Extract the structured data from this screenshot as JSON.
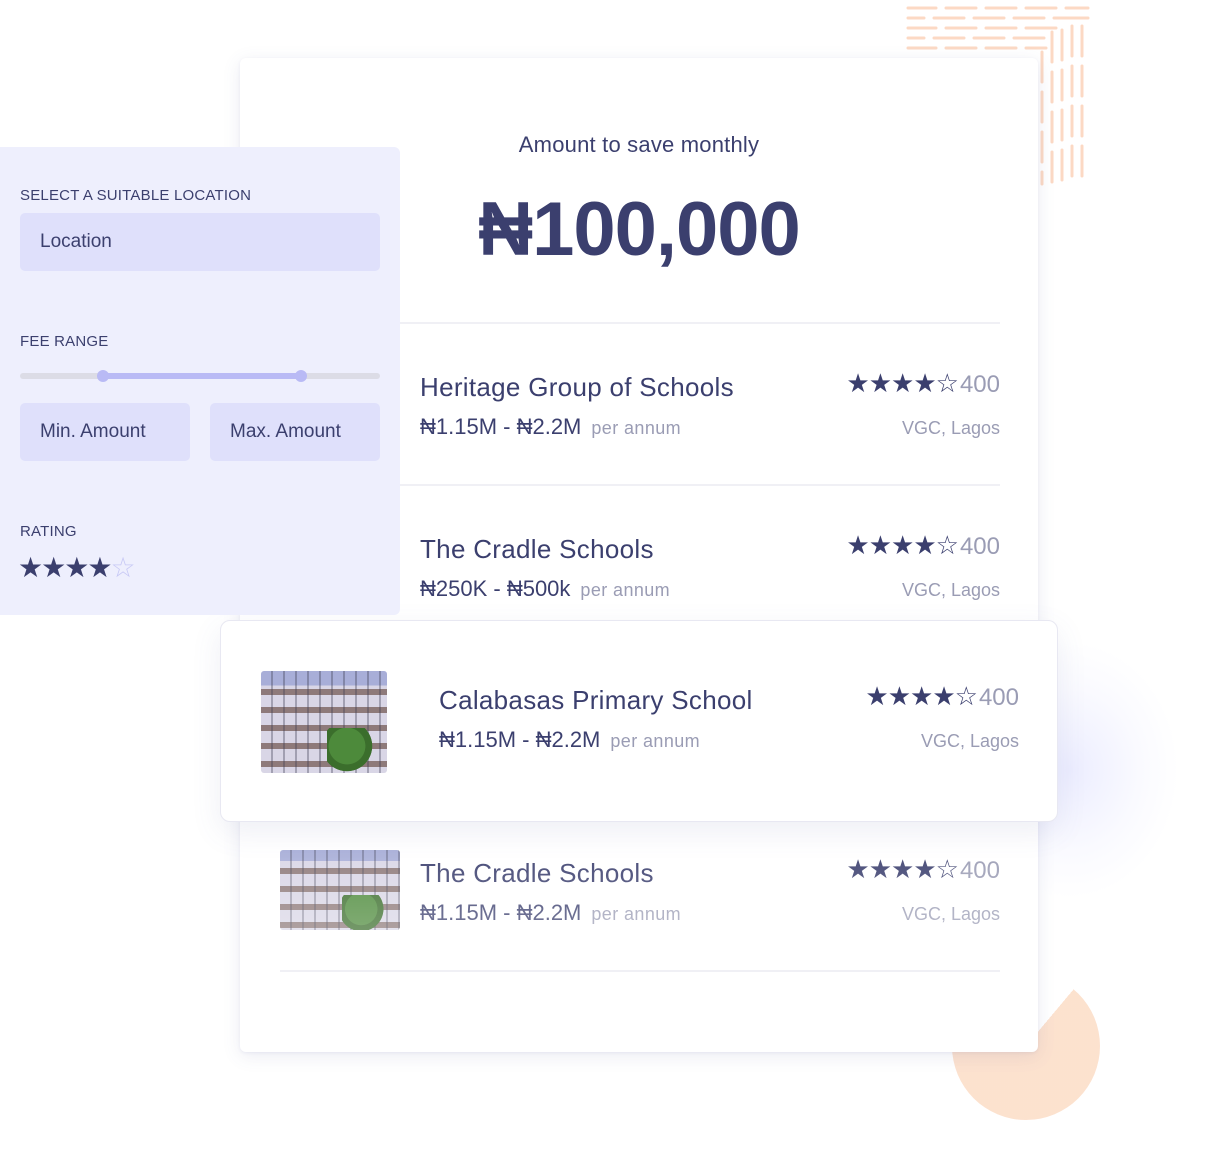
{
  "savings": {
    "label": "Amount to save monthly",
    "amount": "₦100,000"
  },
  "filters": {
    "location_label": "SELECT A SUITABLE LOCATION",
    "location_placeholder": "Location",
    "fee_range_label": "FEE RANGE",
    "fee_range_slider": {
      "min_fraction": 0.23,
      "max_fraction": 0.78
    },
    "min_placeholder": "Min. Amount",
    "max_placeholder": "Max. Amount",
    "rating_label": "RATING",
    "rating_value": 4,
    "rating_max": 5
  },
  "schools": [
    {
      "name": "Heritage Group of Schools",
      "fee": "₦1.15M - ₦2.2M",
      "period": "per annum",
      "rating": 4,
      "rating_max": 5,
      "review_count": "400",
      "location": "VGC, Lagos"
    },
    {
      "name": "The Cradle Schools",
      "fee": "₦250K - ₦500k",
      "period": "per annum",
      "rating": 4,
      "rating_max": 5,
      "review_count": "400",
      "location": "VGC, Lagos"
    },
    {
      "name": "Calabasas Primary School",
      "fee": "₦1.15M - ₦2.2M",
      "period": "per annum",
      "rating": 4,
      "rating_max": 5,
      "review_count": "400",
      "location": "VGC, Lagos"
    },
    {
      "name": "The Cradle Schools",
      "fee": "₦1.15M - ₦2.2M",
      "period": "per annum",
      "rating": 4,
      "rating_max": 5,
      "review_count": "400",
      "location": "VGC, Lagos"
    }
  ],
  "colors": {
    "primary_text": "#3b3f6e",
    "muted_text": "#9a9cb4",
    "panel_bg": "#eeeffd",
    "input_bg": "#dfe0fb",
    "accent_peach": "#fce0cc",
    "slider_accent": "#b9baf5"
  },
  "icons": {
    "star_filled": "star-icon",
    "star_empty": "star-outline-icon"
  }
}
